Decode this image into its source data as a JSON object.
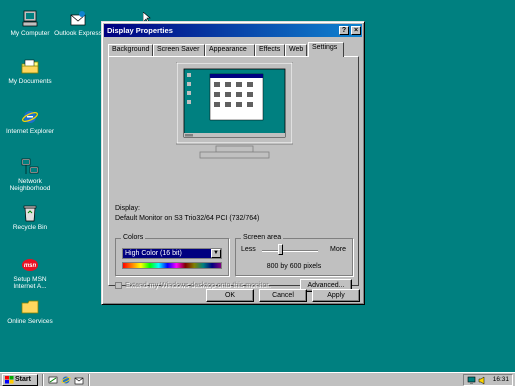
{
  "desktop": {
    "icons": [
      {
        "label": "My Computer",
        "icon": "my-computer-icon"
      },
      {
        "label": "Outlook Express",
        "icon": "outlook-express-icon"
      },
      {
        "label": "My Documents",
        "icon": "folder-icon"
      },
      {
        "label": "Internet Explorer",
        "icon": "internet-explorer-icon"
      },
      {
        "label": "Network Neighborhood",
        "icon": "network-icon"
      },
      {
        "label": "Recycle Bin",
        "icon": "recycle-bin-icon"
      },
      {
        "label": "Setup MSN Internet A...",
        "icon": "msn-icon"
      },
      {
        "label": "Online Services",
        "icon": "folder-icon"
      }
    ]
  },
  "window": {
    "title": "Display Properties",
    "help_button": "?",
    "close_button": "×",
    "tabs": [
      "Background",
      "Screen Saver",
      "Appearance",
      "Effects",
      "Web",
      "Settings"
    ],
    "active_tab": "Settings",
    "display_label": "Display:",
    "display_value": "Default Monitor on S3 Trio32/64 PCI (732/764)",
    "colors": {
      "label": "Colors",
      "selected": "High Color (16 bit)"
    },
    "screen_area": {
      "label": "Screen area",
      "less": "Less",
      "more": "More",
      "value": "800 by 600 pixels",
      "slider_position": 0.33
    },
    "extend_checkbox_label": "Extend my Windows desktop onto this monitor.",
    "extend_checked": false,
    "advanced_button": "Advanced...",
    "ok_button": "OK",
    "cancel_button": "Cancel",
    "apply_button": "Apply"
  },
  "taskbar": {
    "start_label": "Start",
    "clock": "16:31"
  },
  "colors": {
    "desktop": "#008080",
    "title_start": "#000080",
    "title_end": "#1084d0",
    "face": "#c0c0c0"
  }
}
